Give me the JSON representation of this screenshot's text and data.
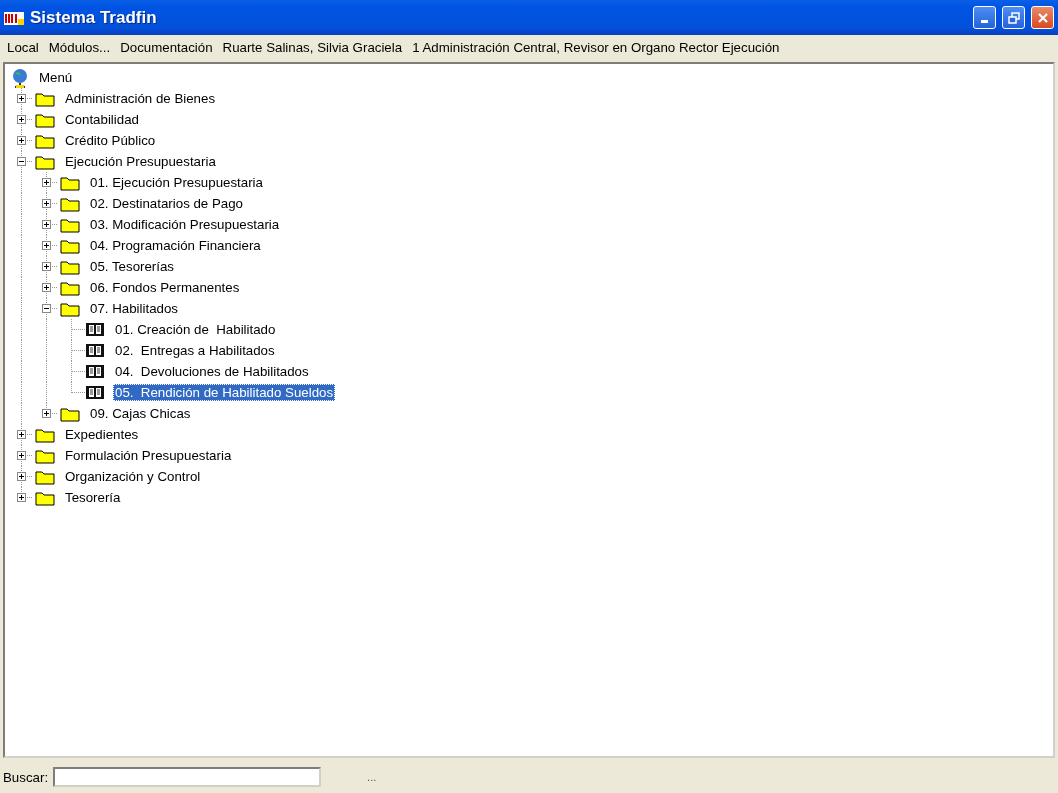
{
  "window": {
    "title": "Sistema Tradfin"
  },
  "menu": [
    "Local",
    "Módulos...",
    "Documentación",
    "Ruarte Salinas, Silvia Graciela",
    "1 Administración Central, Revisor en Organo Rector Ejecución"
  ],
  "tree": {
    "label": "Menú",
    "kind": "root",
    "children": [
      {
        "label": "Administración de Bienes",
        "kind": "folder",
        "expanded": false,
        "selected": false
      },
      {
        "label": "Contabilidad",
        "kind": "folder",
        "expanded": false,
        "selected": false
      },
      {
        "label": "Crédito Público",
        "kind": "folder",
        "expanded": false,
        "selected": false
      },
      {
        "label": "Ejecución Presupuestaria",
        "kind": "folder",
        "expanded": true,
        "selected": false,
        "children": [
          {
            "label": "01. Ejecución Presupuestaria",
            "kind": "folder",
            "expanded": false,
            "selected": false
          },
          {
            "label": "02. Destinatarios de Pago",
            "kind": "folder",
            "expanded": false,
            "selected": false
          },
          {
            "label": "03. Modificación Presupuestaria",
            "kind": "folder",
            "expanded": false,
            "selected": false
          },
          {
            "label": "04. Programación Financiera",
            "kind": "folder",
            "expanded": false,
            "selected": false
          },
          {
            "label": "05. Tesorerías",
            "kind": "folder",
            "expanded": false,
            "selected": false
          },
          {
            "label": "06. Fondos Permanentes",
            "kind": "folder",
            "expanded": false,
            "selected": false
          },
          {
            "label": "07. Habilitados",
            "kind": "folder",
            "expanded": true,
            "selected": false,
            "children": [
              {
                "label": "01. Creación de  Habilitado",
                "kind": "document",
                "selected": false
              },
              {
                "label": "02.  Entregas a Habilitados",
                "kind": "document",
                "selected": false
              },
              {
                "label": "04.  Devoluciones de Habilitados",
                "kind": "document",
                "selected": false
              },
              {
                "label": "05.  Rendición de Habilitado Sueldos",
                "kind": "document",
                "selected": true
              }
            ]
          },
          {
            "label": "09. Cajas Chicas",
            "kind": "folder",
            "expanded": false,
            "selected": false
          }
        ]
      },
      {
        "label": "Expedientes",
        "kind": "folder",
        "expanded": false,
        "selected": false
      },
      {
        "label": "Formulación Presupuestaria",
        "kind": "folder",
        "expanded": false,
        "selected": false
      },
      {
        "label": "Organización y Control",
        "kind": "folder",
        "expanded": false,
        "selected": false
      },
      {
        "label": "Tesorería",
        "kind": "folder",
        "expanded": false,
        "selected": false
      }
    ]
  },
  "search": {
    "label": "Buscar:",
    "hint": "..."
  }
}
